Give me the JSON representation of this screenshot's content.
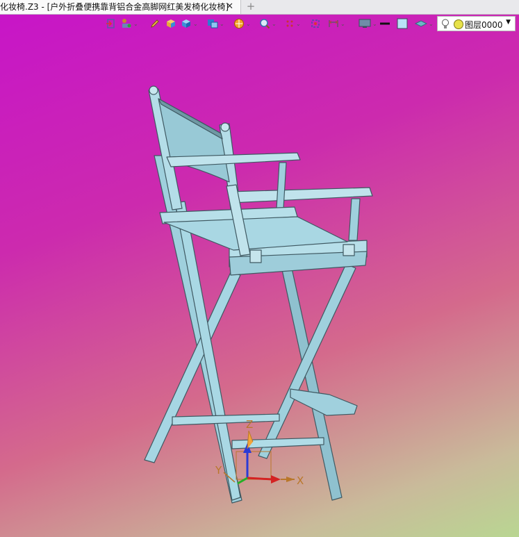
{
  "window": {
    "tab_title": "化妆椅.Z3 - [户外折叠便携靠背铝合金高脚网红美发椅化妆椅]",
    "close_glyph": "✕",
    "new_tab_glyph": "+"
  },
  "toolbar": {
    "icons": [
      "exit-sketch-icon",
      "view-manager-icon",
      "pen-icon",
      "solid-box-icon",
      "cube-view-icon",
      "view-orient-icon",
      "render-mode-icon",
      "zoom-icon",
      "points-icon",
      "frame-icon",
      "dimension-icon",
      "display-icon",
      "line-color-icon",
      "face-color-icon",
      "layer-style-icon"
    ],
    "layer_select": {
      "value": "图层0000",
      "icons": [
        "lightbulb-icon",
        "layer-color-dot-icon"
      ]
    },
    "colors": {
      "line_color": "#111111",
      "face_color": "#b9e3f7"
    }
  },
  "viewport": {
    "axes": {
      "x": "X",
      "y": "Y",
      "z": "Z"
    },
    "model_color": "#9fd0dd",
    "background_top": "#c714c9",
    "background_bottom": "#b9d692"
  }
}
